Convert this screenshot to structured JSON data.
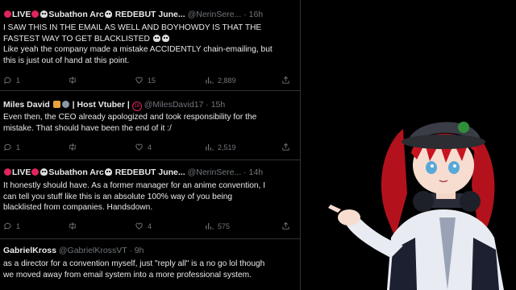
{
  "tweets": [
    {
      "author": "LIVE Subathon Arc REDEBUT June...",
      "handle": "@NerinSere...",
      "time": "16h",
      "lines": [
        "I SAW THIS IN THE EMAIL AS WELL AND BOYHOWDY IS THAT THE",
        "FASTEST WAY TO GET BLACKLISTED",
        "Like yeah the company made a mistake ACCIDENTLY chain-emailing, but",
        "this is just out of hand at this point."
      ],
      "replies": "1",
      "retweets": "",
      "likes": "15",
      "views": "2,889"
    },
    {
      "author": "Miles David",
      "author_suffix": "| Host Vtuber |",
      "handle": "@MilesDavid17",
      "time": "15h",
      "lines": [
        "Even then, the CEO already apologized and took responsibility for the",
        "mistake. That should have been the end of it :/"
      ],
      "replies": "1",
      "retweets": "",
      "likes": "4",
      "views": "2,519"
    },
    {
      "author": "LIVE Subathon Arc REDEBUT June...",
      "handle": "@NerinSere...",
      "time": "14h",
      "lines": [
        "It honestly should have. As a former manager for an anime convention, I",
        "can tell you stuff like this is an absolute 100% way of you being",
        "blacklisted from companies. Handsdown."
      ],
      "replies": "1",
      "retweets": "",
      "likes": "4",
      "views": "575"
    },
    {
      "author": "GabrielKross",
      "handle": "@GabrielKrossVT",
      "time": "9h",
      "lines": [
        "as a director for a convention myself, just \"reply all\" is a no go lol though",
        "we moved away from email system into a more professional system."
      ]
    }
  ],
  "colors": {
    "background": "#000000",
    "text": "#e7e9ea",
    "muted": "#71767b",
    "divider": "#2f3336",
    "live_red": "#e0245e"
  },
  "icons": [
    "reply-icon",
    "retweet-icon",
    "like-icon",
    "views-icon",
    "share-icon",
    "live-dot-icon",
    "skull-emoji-icon"
  ],
  "overlay": {
    "type": "vtuber-avatar",
    "description_name": "red-haired-avatar-with-cap"
  }
}
